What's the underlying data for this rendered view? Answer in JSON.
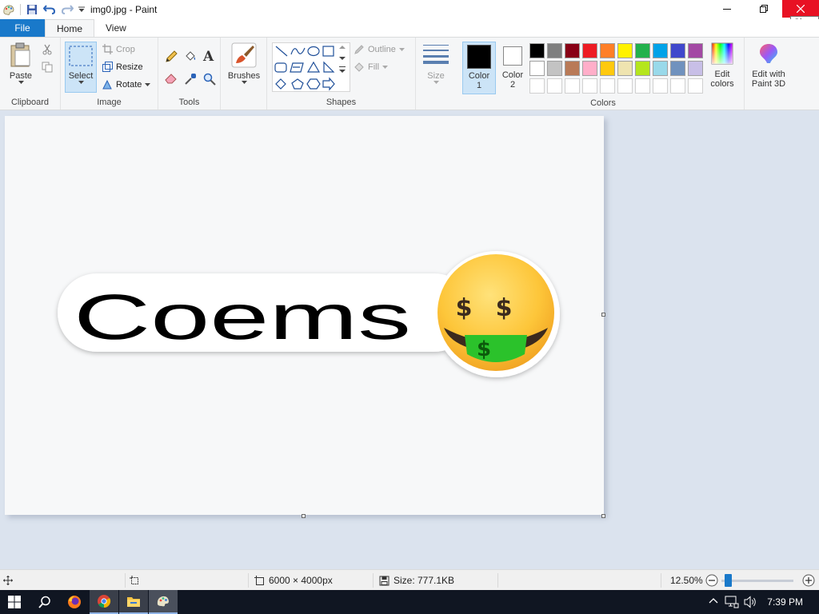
{
  "window": {
    "title": "img0.jpg - Paint",
    "close_tooltip": "Close"
  },
  "tabs": [
    {
      "label": "File"
    },
    {
      "label": "Home"
    },
    {
      "label": "View"
    }
  ],
  "clipboard": {
    "paste": "Paste",
    "group": "Clipboard"
  },
  "image": {
    "select": "Select",
    "crop": "Crop",
    "resize": "Resize",
    "rotate": "Rotate",
    "group": "Image"
  },
  "tools": {
    "group": "Tools"
  },
  "brushes": {
    "label": "Brushes"
  },
  "shapes": {
    "outline": "Outline",
    "fill": "Fill",
    "group": "Shapes"
  },
  "size": {
    "label": "Size"
  },
  "colors": {
    "color1_label": "Color 1",
    "color1_line1": "Color",
    "color1_line2": "1",
    "color2_line1": "Color",
    "color2_line2": "2",
    "color1_value": "#000000",
    "color2_value": "#ffffff",
    "edit_line1": "Edit",
    "edit_line2": "colors",
    "group": "Colors",
    "palette_row1": [
      "#000000",
      "#7f7f7f",
      "#880015",
      "#ed1c24",
      "#ff7f27",
      "#fff200",
      "#22b14c",
      "#00a2e8",
      "#3f48cc",
      "#a349a4"
    ],
    "palette_row2": [
      "#ffffff",
      "#c3c3c3",
      "#b97a57",
      "#ffaec9",
      "#ffc90e",
      "#efe4b0",
      "#b5e61d",
      "#99d9ea",
      "#7092be",
      "#c8bfe7"
    ],
    "palette_row3": [
      "#ffffff",
      "#ffffff",
      "#ffffff",
      "#ffffff",
      "#ffffff",
      "#ffffff",
      "#ffffff",
      "#ffffff",
      "#ffffff",
      "#ffffff"
    ]
  },
  "paint3d": {
    "line1": "Edit with",
    "line2": "Paint 3D"
  },
  "canvas_image": {
    "text": "Coems"
  },
  "status": {
    "dimensions": "6000 × 4000px",
    "size": "Size: 777.1KB",
    "zoom": "12.50%"
  },
  "taskbar": {
    "time": "7:39 PM"
  },
  "icons": {
    "paint_app": "paint-app-icon",
    "save": "save-icon",
    "undo": "undo-icon",
    "redo": "redo-icon",
    "customize": "customize-dropdown-icon",
    "minimize": "minimize-icon",
    "restore": "restore-icon",
    "close": "close-icon"
  }
}
